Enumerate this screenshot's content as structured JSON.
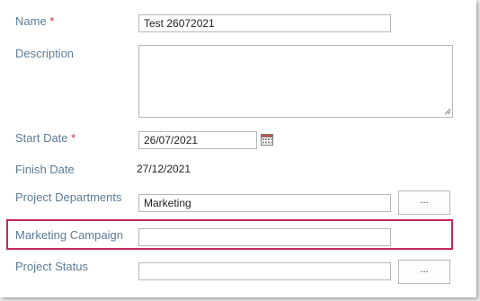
{
  "fields": {
    "name": {
      "label": "Name",
      "required_mark": "*",
      "value": "Test 26072021"
    },
    "description": {
      "label": "Description",
      "value": ""
    },
    "start_date": {
      "label": "Start Date",
      "required_mark": "*",
      "value": "26/07/2021"
    },
    "finish_date": {
      "label": "Finish Date",
      "value": "27/12/2021"
    },
    "project_departments": {
      "label": "Project Departments",
      "value": "Marketing",
      "browse_label": "..."
    },
    "marketing_campaign": {
      "label": "Marketing Campaign",
      "value": ""
    },
    "project_status": {
      "label": "Project Status",
      "value": "",
      "browse_label": "..."
    }
  },
  "icons": {
    "date_picker": "calendar-icon",
    "resize": "resize-grip-icon"
  },
  "colors": {
    "label": "#5b7c99",
    "required": "#cc3333",
    "highlight": "#c8275a",
    "border": "#b8b8b8"
  }
}
